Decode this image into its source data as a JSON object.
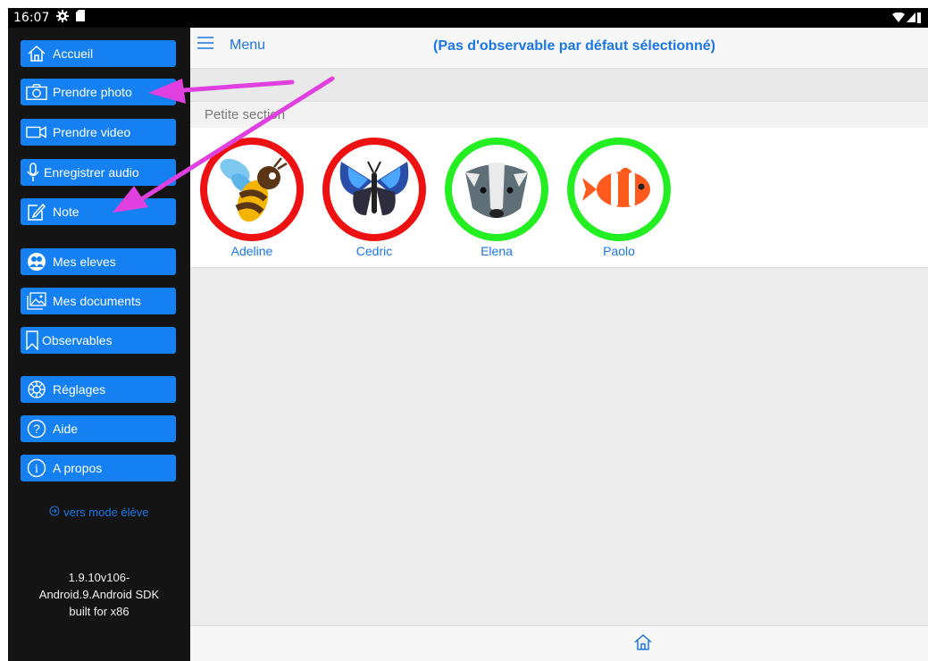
{
  "statusbar": {
    "time": "16:07"
  },
  "sidebar": {
    "items": [
      {
        "label": "Accueil",
        "icon": "home-icon"
      },
      {
        "label": "Prendre photo",
        "icon": "camera-icon"
      },
      {
        "label": "Prendre video",
        "icon": "video-camera-icon"
      },
      {
        "label": "Enregistrer audio",
        "icon": "microphone-icon"
      },
      {
        "label": "Note",
        "icon": "note-edit-icon"
      },
      {
        "label": "Mes eleves",
        "icon": "students-icon"
      },
      {
        "label": "Mes documents",
        "icon": "image-document-icon"
      },
      {
        "label": "Observables",
        "icon": "bookmark-icon"
      },
      {
        "label": "Réglages",
        "icon": "settings-icon"
      },
      {
        "label": "Aide",
        "icon": "help-icon"
      },
      {
        "label": "A propos",
        "icon": "info-icon"
      }
    ],
    "student_mode": "vers mode élève",
    "version_lines": [
      "1.9.10v106-",
      "Android.9.Android SDK",
      "built for x86"
    ]
  },
  "header": {
    "menu_label": "Menu",
    "title": "(Pas d'observable par défaut sélectionné)"
  },
  "section": {
    "label": "Petite section"
  },
  "students": [
    {
      "name": "Adeline",
      "ring_color": "#ee1111",
      "animal": "bee-icon"
    },
    {
      "name": "Cedric",
      "ring_color": "#ee1111",
      "animal": "butterfly-icon"
    },
    {
      "name": "Elena",
      "ring_color": "#22ee22",
      "animal": "badger-icon"
    },
    {
      "name": "Paolo",
      "ring_color": "#22ee22",
      "animal": "clownfish-icon"
    }
  ],
  "colors": {
    "accent": "#1a77e5",
    "button": "#1480f2",
    "sidebar": "#141414",
    "annotation_arrow": "#e040e0"
  }
}
